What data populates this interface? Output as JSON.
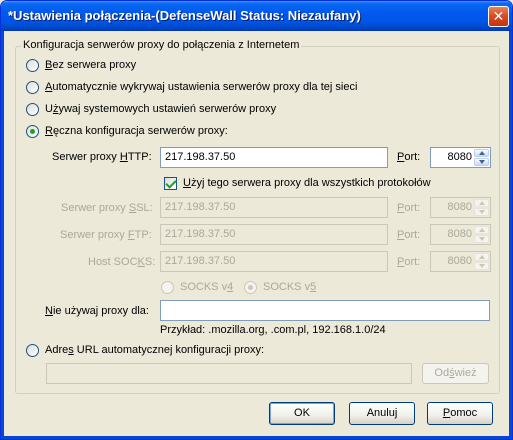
{
  "window": {
    "title": "*Ustawienia połączenia-(DefenseWall Status: Niezaufany)",
    "close_glyph": "✕"
  },
  "group": {
    "legend": "Konfiguracja serwerów proxy do połączenia z Internetem"
  },
  "radios": {
    "no_proxy": {
      "pre": "",
      "key": "B",
      "post": "ez serwera proxy",
      "checked": false
    },
    "auto_detect": {
      "pre": "",
      "key": "A",
      "post": "utomatycznie wykrywaj ustawienia serwerów proxy dla tej sieci",
      "checked": false
    },
    "system": {
      "pre": "U",
      "key": "ż",
      "post": "ywaj systemowych ustawień serwerów proxy",
      "checked": false
    },
    "manual": {
      "pre": "",
      "key": "R",
      "post": "ęczna konfiguracja serwerów proxy:",
      "checked": true
    },
    "auto_url": {
      "pre": "Adre",
      "key": "s",
      "post": " URL automatycznej konfiguracji proxy:",
      "checked": false
    }
  },
  "http": {
    "label_pre": "Serwer proxy ",
    "label_key": "H",
    "label_post": "TTP:",
    "value": "217.198.37.50",
    "port_label_key": "P",
    "port_label_post": "ort:",
    "port": "8080"
  },
  "use_for_all": {
    "pre": "",
    "key": "U",
    "post": "żyj tego serwera proxy dla wszystkich protokołów",
    "checked": true
  },
  "ssl": {
    "label_pre": "Serwer proxy ",
    "label_key": "S",
    "label_post": "SL:",
    "value": "217.198.37.50",
    "port_label_key": "P",
    "port_label_post": "ort:",
    "port": "8080"
  },
  "ftp": {
    "label_pre": "Serwer proxy ",
    "label_key": "F",
    "label_post": "TP:",
    "value": "217.198.37.50",
    "port_label_key": "P",
    "port_label_post": "ort:",
    "port": "8080"
  },
  "socks": {
    "label_pre": "Host SOC",
    "label_key": "K",
    "label_post": "S:",
    "value": "217.198.37.50",
    "port_label_key": "P",
    "port_label_post": "ort:",
    "port": "8080",
    "v4_pre": "SOCKS v",
    "v4_key": "4",
    "v4_checked": false,
    "v5_pre": "SOCKS v",
    "v5_key": "5",
    "v5_checked": true
  },
  "no_proxy_for": {
    "label_pre": "",
    "label_key": "N",
    "label_post": "ie używaj proxy dla:",
    "value": "",
    "example": "Przykład: .mozilla.org, .com.pl, 192.168.1.0/24"
  },
  "auto_url": {
    "value": "",
    "reload_pre": "Od",
    "reload_key": "ś",
    "reload_post": "wież"
  },
  "buttons": {
    "ok": "OK",
    "cancel": "Anuluj",
    "help_key": "P",
    "help_post": "omoc"
  },
  "colors": {
    "titlebar": "#0055e5",
    "dialog_bg": "#ece9d8",
    "radio_dot": "#21a121",
    "disabled_text": "#aca899"
  }
}
